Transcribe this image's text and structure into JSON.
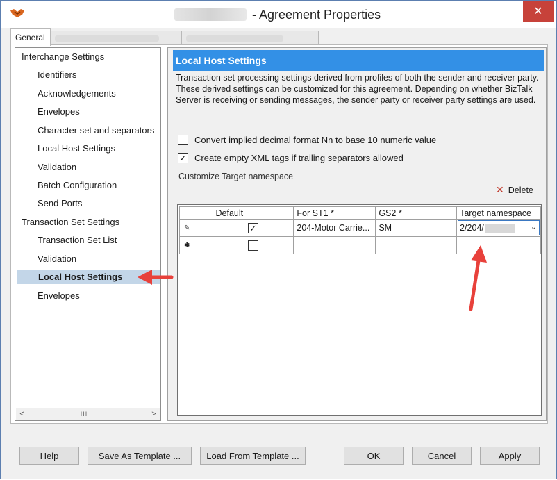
{
  "window": {
    "title": "- Agreement Properties",
    "close_glyph": "✕",
    "app_icon": "biztalk-app-icon"
  },
  "tabs": [
    {
      "label": "General"
    }
  ],
  "tree": {
    "items": [
      {
        "label": "Interchange Settings"
      },
      {
        "label": "Identifiers"
      },
      {
        "label": "Acknowledgements"
      },
      {
        "label": "Envelopes"
      },
      {
        "label": "Character set and separators"
      },
      {
        "label": "Local Host Settings"
      },
      {
        "label": "Validation"
      },
      {
        "label": "Batch Configuration"
      },
      {
        "label": "Send Ports"
      },
      {
        "label": "Transaction Set Settings"
      },
      {
        "label": "Transaction Set List"
      },
      {
        "label": "Validation"
      },
      {
        "label": "Local Host Settings"
      },
      {
        "label": "Envelopes"
      }
    ],
    "selected_index": 12,
    "scroll_left": "<",
    "scroll_right": ">",
    "scroll_grip": "III"
  },
  "panel": {
    "header": "Local Host Settings",
    "description": "Transaction set processing settings derived from profiles of both the sender and receiver party. These derived settings can be customized for this agreement. Depending on whether BizTalk Server is receiving or sending messages, the sender party or receiver party settings are used.",
    "checkbox1": {
      "label": "Convert implied decimal format Nn to base 10 numeric value",
      "checked": false
    },
    "checkbox2": {
      "label": "Create empty XML tags if trailing separators allowed",
      "checked": true
    },
    "check_glyph": "✓",
    "group_label": "Customize Target namespace",
    "delete_label": "Delete",
    "delete_glyph": "✕"
  },
  "grid": {
    "columns": [
      "Default",
      "For ST1 *",
      "GS2 *",
      "Target namespace"
    ],
    "rows": [
      {
        "marker": "✎",
        "default_checked": true,
        "for_st1": "204-Motor Carrie...",
        "gs2": "SM",
        "target_namespace": "2/204/"
      },
      {
        "marker": "✱",
        "default_checked": false,
        "for_st1": "",
        "gs2": "",
        "target_namespace": ""
      }
    ],
    "dropdown_glyph": "⌄"
  },
  "buttons": {
    "help": "Help",
    "save_template": "Save As Template ...",
    "load_template": "Load From Template ...",
    "ok": "OK",
    "cancel": "Cancel",
    "apply": "Apply"
  },
  "annotation_color": "#e8413b"
}
